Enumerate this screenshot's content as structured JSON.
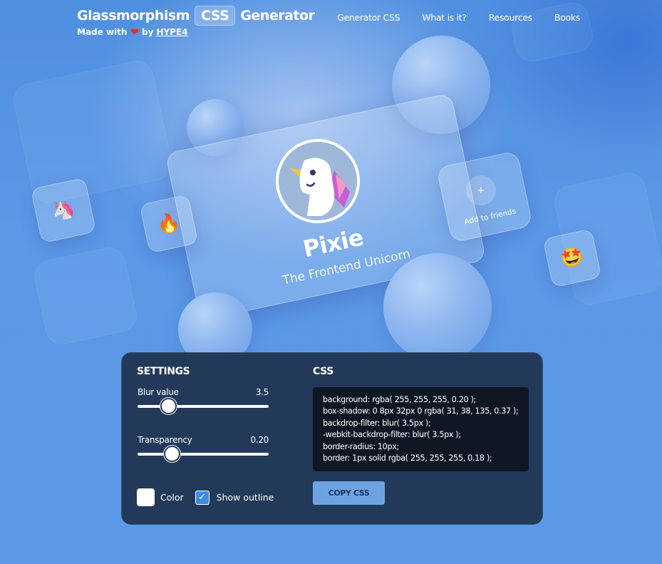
{
  "header": {
    "title_before": "Glassmorphism",
    "title_pill": "CSS",
    "title_after": "Generator",
    "made_with": "Made with",
    "heart_icon": "heart-icon",
    "by": "by",
    "author_link": "HYPE4"
  },
  "nav": {
    "items": [
      "Generator CSS",
      "What is it?",
      "Resources",
      "Books"
    ]
  },
  "showcase": {
    "name": "Pixie",
    "subtitle": "The Frontend Unicorn",
    "add_friends_label": "Add to friends",
    "add_friends_plus": "+",
    "emoji_unicorn": "🦄",
    "emoji_fire": "🔥",
    "emoji_starstruck": "🤩"
  },
  "settings": {
    "heading": "SETTINGS",
    "blur_label": "Blur value",
    "blur_value": "3.5",
    "blur_fraction": 0.2,
    "transparency_label": "Transparency",
    "transparency_value": "0.20",
    "transparency_fraction": 0.23,
    "color_label": "Color",
    "show_outline_label": "Show outline",
    "show_outline_checked": true,
    "checkmark": "✓"
  },
  "css_panel": {
    "heading": "CSS",
    "lines": [
      "background: rgba( 255, 255, 255, 0.20 );",
      "box-shadow: 0 8px 32px 0 rgba( 31, 38, 135, 0.37 );",
      "backdrop-filter: blur( 3.5px );",
      "-webkit-backdrop-filter: blur( 3.5px );",
      "border-radius: 10px;",
      "border: 1px solid rgba( 255, 255, 255, 0.18 );"
    ],
    "copy_button": "COPY CSS"
  },
  "colors": {
    "background": "#5b98e6",
    "panel": "#22395a",
    "code_bg": "#0f1725",
    "button": "#6ea3e3",
    "checkbox_checked": "#3e8be8",
    "heart": "#e5322f"
  }
}
